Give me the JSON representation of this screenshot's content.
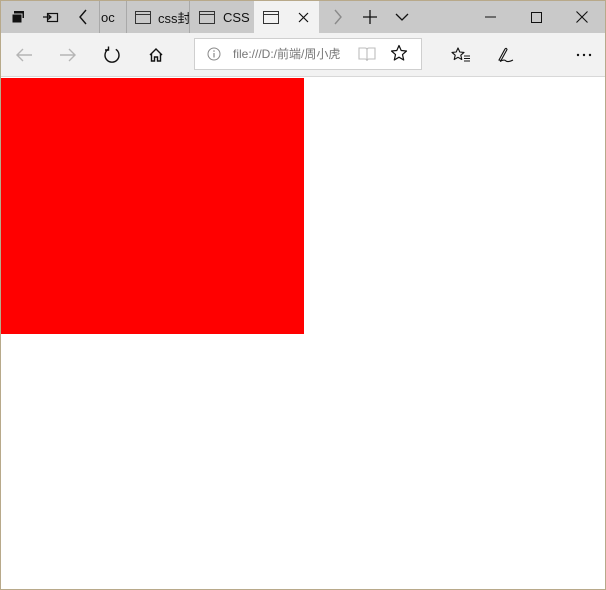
{
  "tabs": [
    {
      "label": "oc"
    },
    {
      "label": "css封"
    },
    {
      "label": "CSS"
    },
    {
      "label": ""
    }
  ],
  "address_bar": {
    "url": "file:///D:/前端/周小虎"
  },
  "page": {
    "box_color": "#ff0000"
  }
}
